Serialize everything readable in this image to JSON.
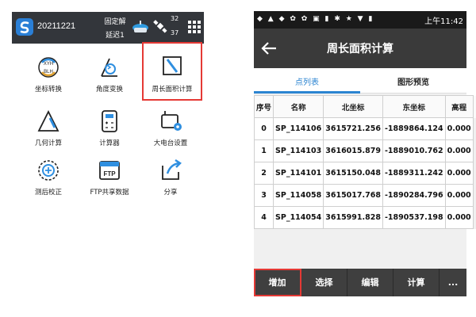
{
  "left_app": {
    "project_name": "20211221",
    "solution_status": "固定解",
    "latency": "延迟1",
    "sat_used": "32",
    "sat_visible": "37",
    "tiles": [
      {
        "label": "坐标转换",
        "icon": "coordinate-transform-icon"
      },
      {
        "label": "角度变换",
        "icon": "angle-transform-icon"
      },
      {
        "label": "周长面积计算",
        "icon": "perimeter-area-icon"
      },
      {
        "label": "几何计算",
        "icon": "geometry-icon"
      },
      {
        "label": "计算器",
        "icon": "calculator-icon"
      },
      {
        "label": "大电台设置",
        "icon": "radio-settings-icon"
      },
      {
        "label": "测后校正",
        "icon": "post-correction-icon"
      },
      {
        "label": "FTP共享数据",
        "icon": "ftp-icon"
      },
      {
        "label": "分享",
        "icon": "share-icon"
      }
    ],
    "highlight_color": "#e53935"
  },
  "right_app": {
    "status_time": "上午11:42",
    "title": "周长面积计算",
    "tabs": [
      "点列表",
      "图形预览"
    ],
    "columns": [
      "序号",
      "名称",
      "北坐标",
      "东坐标",
      "高程"
    ],
    "rows": [
      [
        "0",
        "SP_114106",
        "3615721.256",
        "-1889864.124",
        "0.000"
      ],
      [
        "1",
        "SP_114103",
        "3616015.879",
        "-1889010.762",
        "0.000"
      ],
      [
        "2",
        "SP_114101",
        "3615150.048",
        "-1889311.242",
        "0.000"
      ],
      [
        "3",
        "SP_114058",
        "3615017.768",
        "-1890284.796",
        "0.000"
      ],
      [
        "4",
        "SP_114054",
        "3615991.828",
        "-1890537.198",
        "0.000"
      ]
    ],
    "bottom_buttons": [
      "增加",
      "选择",
      "编辑",
      "计算",
      "..."
    ],
    "accent_color": "#2b84d1"
  }
}
